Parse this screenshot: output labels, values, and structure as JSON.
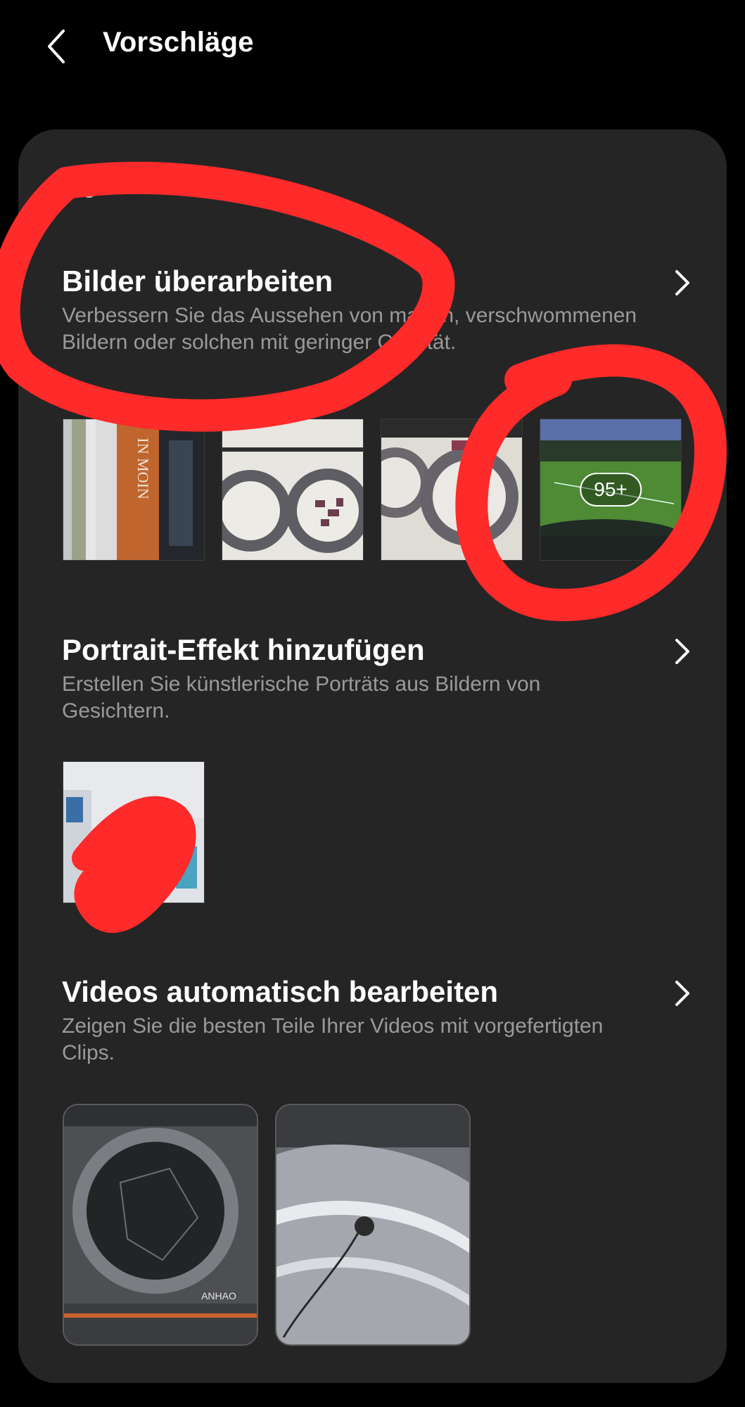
{
  "header": {
    "title": "Vorschläge"
  },
  "card": {
    "section_header": "...gieren"
  },
  "sections": [
    {
      "title": "Bilder überarbeiten",
      "description": "Verbessern Sie das Aussehen von matten, verschwommenen Bildern oder solchen mit geringer Qualität.",
      "more_count": "95+"
    },
    {
      "title": "Portrait-Effekt hinzufügen",
      "description": "Erstellen Sie künstlerische Porträts aus Bildern von Gesichtern."
    },
    {
      "title": "Videos automatisch bearbeiten",
      "description": "Zeigen Sie die besten Teile Ihrer Videos mit vorgefertigten Clips."
    }
  ],
  "images": {
    "banner_text": "IN MOIN",
    "logo_text": "ANHAO"
  },
  "colors": {
    "background": "#000000",
    "card": "#252525",
    "title": "#ffffff",
    "description": "#9a9a9a",
    "annotation_red": "#ff2a2a"
  }
}
